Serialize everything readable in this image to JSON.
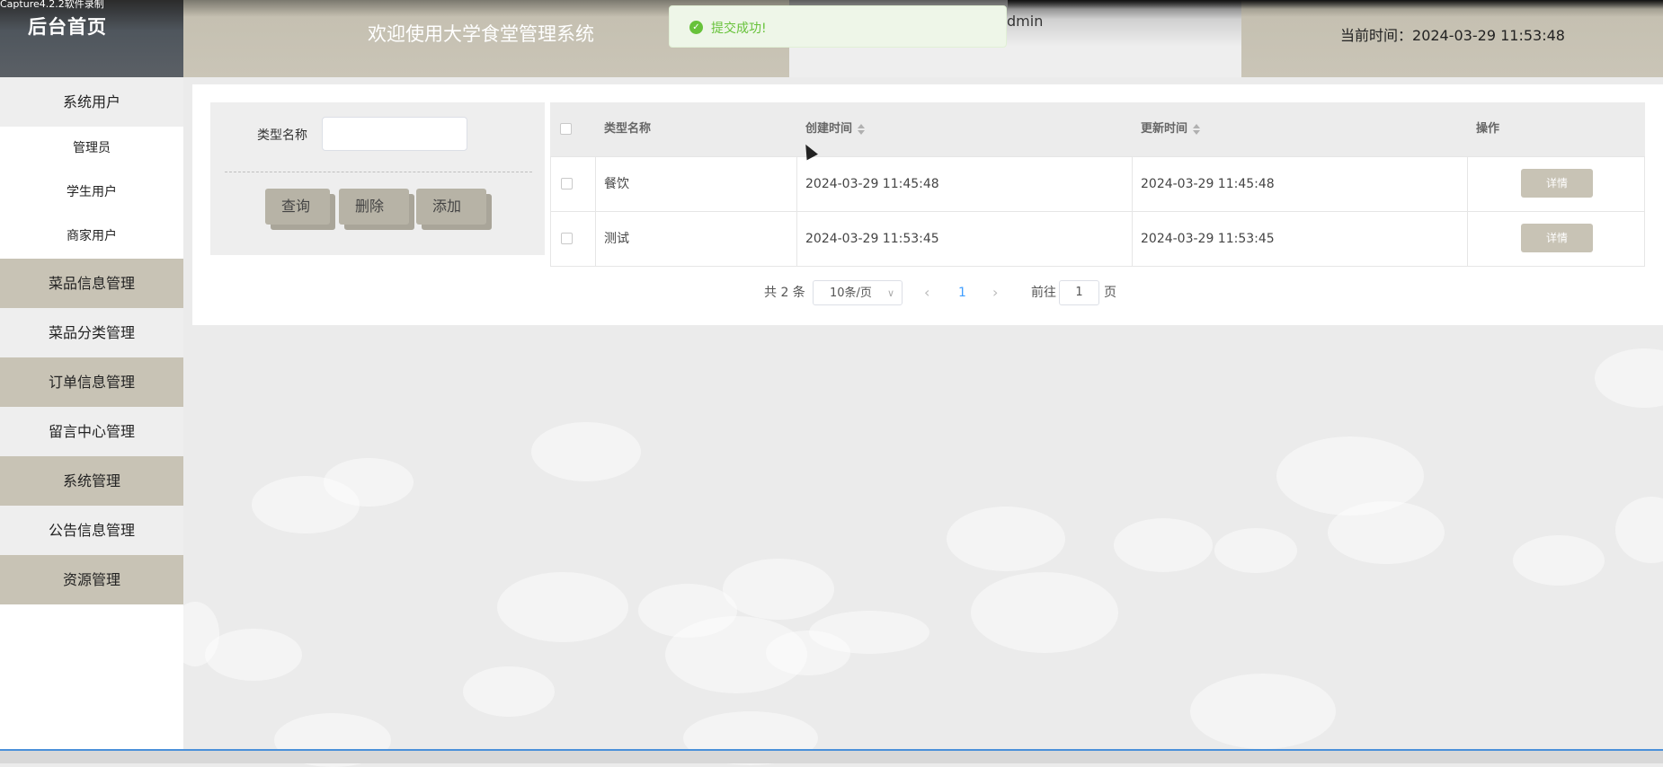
{
  "recorder_watermark": "Capture4.2.2软件录制",
  "header": {
    "brand_title": "后台首页",
    "welcome": "欢迎使用大学食堂管理系统",
    "username": "dmin",
    "time_label": "当前时间：",
    "time_value": "2024-03-29 11:53:48"
  },
  "toast": {
    "type": "success",
    "icon": "check-circle-icon",
    "message": "提交成功!",
    "color": "#67c23a"
  },
  "sidebar": {
    "items": [
      {
        "label": "系统用户",
        "children": [
          "管理员",
          "学生用户",
          "商家用户"
        ]
      },
      {
        "label": "菜品信息管理"
      },
      {
        "label": "菜品分类管理"
      },
      {
        "label": "订单信息管理"
      },
      {
        "label": "留言中心管理"
      },
      {
        "label": "系统管理"
      },
      {
        "label": "公告信息管理"
      },
      {
        "label": "资源管理"
      }
    ]
  },
  "search": {
    "label": "类型名称",
    "value": "",
    "buttons": {
      "query": "查询",
      "delete": "删除",
      "add": "添加"
    }
  },
  "table": {
    "columns": [
      "类型名称",
      "创建时间",
      "更新时间",
      "操作"
    ],
    "rows": [
      {
        "name": "餐饮",
        "created": "2024-03-29 11:45:48",
        "updated": "2024-03-29 11:45:48",
        "action": "详情"
      },
      {
        "name": "测试",
        "created": "2024-03-29 11:53:45",
        "updated": "2024-03-29 11:53:45",
        "action": "详情"
      }
    ]
  },
  "pagination": {
    "total_text": "共 2 条",
    "page_size": "10条/页",
    "current_page": "1",
    "goto_label": "前往",
    "goto_value": "1",
    "page_unit": "页"
  },
  "colors": {
    "accent": "#c8c3b5",
    "header_dark": "#4f565d",
    "success": "#67c23a",
    "link": "#409eff"
  }
}
